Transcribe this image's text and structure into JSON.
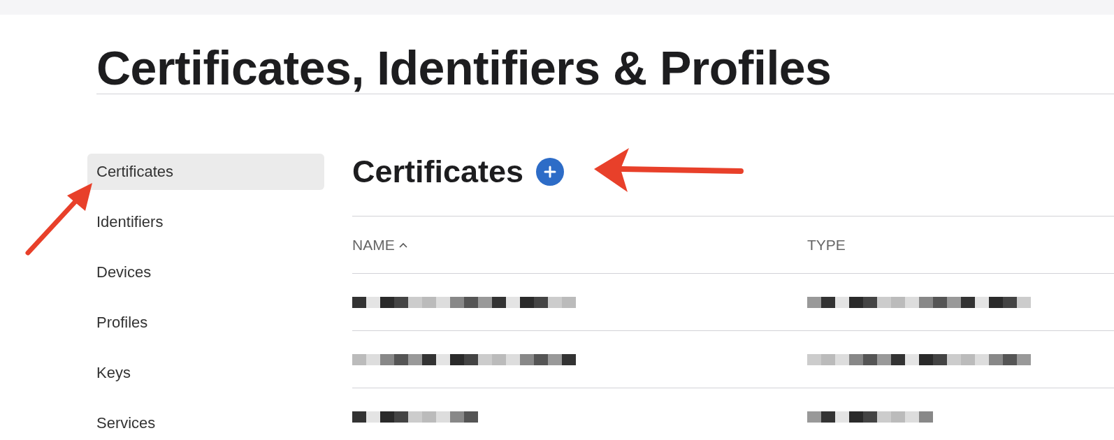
{
  "page": {
    "title": "Certificates, Identifiers & Profiles"
  },
  "sidebar": {
    "items": [
      {
        "label": "Certificates",
        "selected": true
      },
      {
        "label": "Identifiers",
        "selected": false
      },
      {
        "label": "Devices",
        "selected": false
      },
      {
        "label": "Profiles",
        "selected": false
      },
      {
        "label": "Keys",
        "selected": false
      },
      {
        "label": "Services",
        "selected": false
      }
    ]
  },
  "section": {
    "title": "Certificates"
  },
  "table": {
    "columns": [
      {
        "label": "NAME",
        "sorted": true
      },
      {
        "label": "TYPE",
        "sorted": false
      }
    ],
    "rows": [
      {
        "cells": [
          {
            "kind": "redacted"
          },
          {
            "kind": "redacted"
          }
        ]
      },
      {
        "cells": [
          {
            "kind": "redacted"
          },
          {
            "kind": "redacted"
          }
        ]
      },
      {
        "cells": [
          {
            "kind": "redacted"
          },
          {
            "kind": "redacted"
          }
        ]
      }
    ]
  },
  "annotations": [
    {
      "kind": "arrow"
    },
    {
      "kind": "arrow"
    }
  ]
}
